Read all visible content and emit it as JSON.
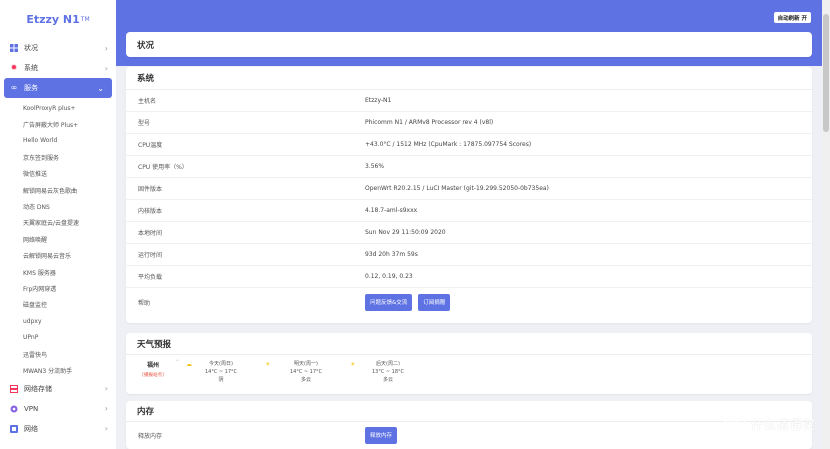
{
  "brand": {
    "name": "Etzzy N1",
    "tm": "TM"
  },
  "sidebar": {
    "items_top": [
      {
        "label": "状况",
        "icon": "dashboard-icon",
        "color": "#5e72e4"
      },
      {
        "label": "系统",
        "icon": "gear-icon",
        "color": "#f5365c"
      },
      {
        "label": "服务",
        "icon": "link-icon",
        "color": "#ffffff"
      }
    ],
    "sub_items": [
      "KoolProxyR plus+",
      "广告屏蔽大师 Plus+",
      "Hello World",
      "京东签到服务",
      "微信推送",
      "解锁网易云灰色歌曲",
      "动态 DNS",
      "天翼家庭云/云盘提速",
      "网络唤醒",
      "云解锁网易云音乐",
      "KMS 服务器",
      "Frp内网穿透",
      "磁盘监控",
      "udpxy",
      "UPnP",
      "迅雷快鸟",
      "MWAN3 分流助手"
    ],
    "items_bottom": [
      {
        "label": "网络存储",
        "icon": "storage-icon",
        "color": "#f5365c"
      },
      {
        "label": "VPN",
        "icon": "vpn-icon",
        "color": "#8965e0"
      },
      {
        "label": "网络",
        "icon": "network-icon",
        "color": "#5e72e4"
      }
    ]
  },
  "header": {
    "auto_refresh": "自动刷新 开"
  },
  "page": {
    "title": "状况"
  },
  "system": {
    "title": "系统",
    "rows": [
      {
        "key": "主机名",
        "value": "Etzzy-N1"
      },
      {
        "key": "型号",
        "value": "Phicomm N1 / ARMv8 Processor rev 4 (v8l)"
      },
      {
        "key": "CPU温度",
        "value": "+43.0°C / 1512 MHz (CpuMark : 17875.097754 Scores)"
      },
      {
        "key": "CPU 使用率（%）",
        "value": "3.56%"
      },
      {
        "key": "固件版本",
        "value": "OpenWrt R20.2.15 / LuCI Master (git-19.299.52050-0b735ea)"
      },
      {
        "key": "内核版本",
        "value": "4.18.7-aml-s9xxx"
      },
      {
        "key": "本地时间",
        "value": "Sun Nov 29 11:50:09 2020"
      },
      {
        "key": "运行时间",
        "value": "93d 20h 37m 59s"
      },
      {
        "key": "平均负载",
        "value": "0.12, 0.19, 0.23"
      }
    ],
    "help_key": "帮助",
    "help_buttons": [
      "问题反馈&交流",
      "订阅捐赠"
    ]
  },
  "weather": {
    "title": "天气预报",
    "city": "福州",
    "source": "[播报站点]",
    "days": [
      {
        "day": "今天(周日)",
        "temp": "14°C ~ 17°C",
        "desc": "阴"
      },
      {
        "day": "明天(周一)",
        "temp": "14°C ~ 17°C",
        "desc": "多云"
      },
      {
        "day": "后天(周二)",
        "temp": "13°C ~ 18°C",
        "desc": "多云"
      }
    ]
  },
  "memory": {
    "title": "内存",
    "row_key": "释放内存",
    "button": "释放内存"
  },
  "watermark": {
    "logo": "值",
    "text": "什么值得买"
  }
}
